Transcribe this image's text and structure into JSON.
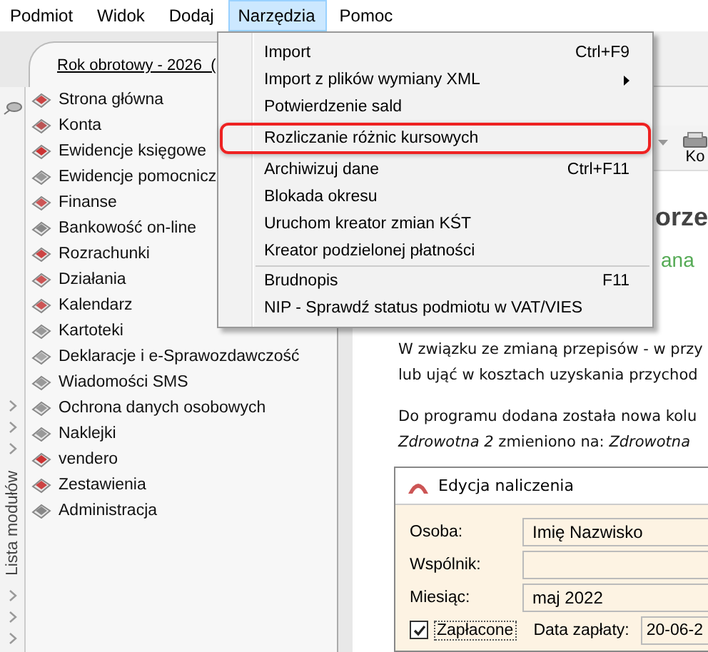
{
  "menubar": [
    {
      "label": "Podmiot",
      "selected": false
    },
    {
      "label": "Widok",
      "selected": false
    },
    {
      "label": "Dodaj",
      "selected": false
    },
    {
      "label": "Narzędzia",
      "selected": true
    },
    {
      "label": "Pomoc",
      "selected": false
    }
  ],
  "year_tab": "Rok obrotowy - 2026  (",
  "sidebar": {
    "title": "Lista modułów",
    "items": [
      "Strona główna",
      "Konta",
      "Ewidencje księgowe",
      "Ewidencje pomocnicz",
      "Finanse",
      "Bankowość on-line",
      "Rozrachunki",
      "Działania",
      "Kalendarz",
      "Kartoteki",
      "Deklaracje i e-Sprawozdawczość",
      "Wiadomości SMS",
      "Ochrona danych osobowych",
      "Naklejki",
      "vendero",
      "Zestawienia",
      "Administracja"
    ]
  },
  "menu": [
    {
      "kind": "item",
      "label": "Import",
      "shortcut": "Ctrl+F9",
      "submenu": false,
      "outlined": false
    },
    {
      "kind": "item",
      "label": "Import z plików wymiany XML",
      "submenu": true,
      "outlined": false
    },
    {
      "kind": "item",
      "label": "Potwierdzenie sald",
      "submenu": false,
      "outlined": false
    },
    {
      "kind": "item",
      "label": "Rozliczanie różnic kursowych",
      "submenu": false,
      "outlined": true
    },
    {
      "kind": "item",
      "label": "Archiwizuj dane",
      "shortcut": "Ctrl+F11",
      "submenu": false,
      "outlined": false
    },
    {
      "kind": "item",
      "label": "Blokada okresu",
      "submenu": false,
      "outlined": false
    },
    {
      "kind": "item",
      "label": "Uruchom kreator zmian KŚT",
      "submenu": false,
      "outlined": false
    },
    {
      "kind": "item",
      "label": "Kreator podzielonej płatności",
      "submenu": false,
      "outlined": false
    },
    {
      "kind": "separator"
    },
    {
      "kind": "item",
      "label": "Brudnopis",
      "shortcut": "F11",
      "submenu": false,
      "outlined": false
    },
    {
      "kind": "item",
      "label": "NIP - Sprawdź status podmiotu w VAT/VIES",
      "submenu": false,
      "outlined": false
    }
  ],
  "toolbar": {
    "button_label": "Ko"
  },
  "article": {
    "heading": "orze",
    "subheading": "ana",
    "paragraphs": [
      "W związku ze zmianą przepisów - w przy\nlub ująć w kosztach uzyskania przychod",
      "Do programu dodana została nowa kolu\n*Zdrowotna 2* zmieniono na: *Zdrowotna*"
    ]
  },
  "dialog": {
    "title": "Edycja naliczenia",
    "fields": [
      {
        "label": "Osoba:",
        "value": "Imię Nazwisko"
      },
      {
        "label": "Wspólnik:"
      },
      {
        "label": "Miesiąc:",
        "value": "maj 2022"
      }
    ],
    "paid": {
      "label": "Zapłacone",
      "checked": true
    },
    "date_label": "Data zapłaty:",
    "date_value": "20-06-2"
  }
}
